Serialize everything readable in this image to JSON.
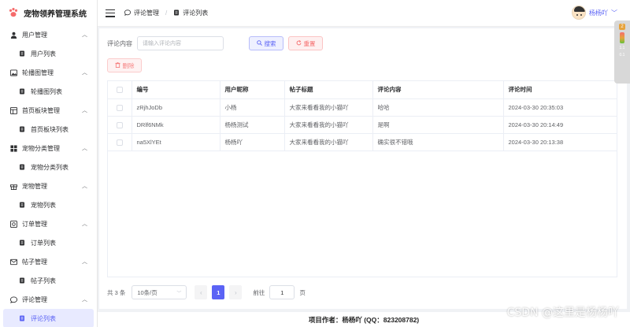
{
  "app": {
    "title": "宠物领养管理系统"
  },
  "sidebar": {
    "groups": [
      {
        "label": "用户管理",
        "icon": "user-icon",
        "item": "用户列表"
      },
      {
        "label": "轮播图管理",
        "icon": "image-icon",
        "item": "轮播图列表"
      },
      {
        "label": "首页板块管理",
        "icon": "layout-icon",
        "item": "首页板块列表"
      },
      {
        "label": "宠物分类管理",
        "icon": "grid-icon",
        "item": "宠物分类列表"
      },
      {
        "label": "宠物管理",
        "icon": "gift-icon",
        "item": "宠物列表"
      },
      {
        "label": "订单管理",
        "icon": "order-icon",
        "item": "订单列表"
      },
      {
        "label": "帖子管理",
        "icon": "mail-icon",
        "item": "帖子列表"
      },
      {
        "label": "评论管理",
        "icon": "comment-icon",
        "item": "评论列表"
      }
    ]
  },
  "header": {
    "breadcrumb": [
      "评论管理",
      "评论列表"
    ],
    "user_name": "杨杨吖"
  },
  "filter": {
    "label": "评论内容",
    "placeholder": "请输入评论内容",
    "value": "",
    "search_label": "搜索",
    "reset_label": "重置",
    "delete_label": "删除"
  },
  "table": {
    "columns": [
      "编号",
      "用户昵称",
      "帖子标题",
      "评论内容",
      "评论时间"
    ],
    "rows": [
      [
        "zRjhJoDb",
        "小杨",
        "大家来看看我的小猫吖",
        "哈哈",
        "2024-03-30 20:35:03"
      ],
      [
        "DRlf6NMk",
        "杨杨测试",
        "大家来看看我的小猫吖",
        "是啊",
        "2024-03-30 20:14:49"
      ],
      [
        "na5XlYEt",
        "杨杨吖",
        "大家来看看我的小猫吖",
        "确实很不错哦",
        "2024-03-30 20:13:38"
      ]
    ]
  },
  "pagination": {
    "total": "共 3 条",
    "page_size": "10条/页",
    "current_page": "1",
    "goto_label": "前往",
    "goto_value": "1",
    "goto_unit": "页"
  },
  "footer": {
    "text": "项目作者：杨杨吖 (QQ：823208782)"
  },
  "watermark": "CSDN @这里是杨杨吖",
  "float_widget": {
    "badge": "2",
    "lines": [
      "1.1",
      "0.1"
    ]
  },
  "colors": {
    "primary": "#5b63f5",
    "danger": "#f56c6c",
    "active_bg": "#e8eaff"
  }
}
